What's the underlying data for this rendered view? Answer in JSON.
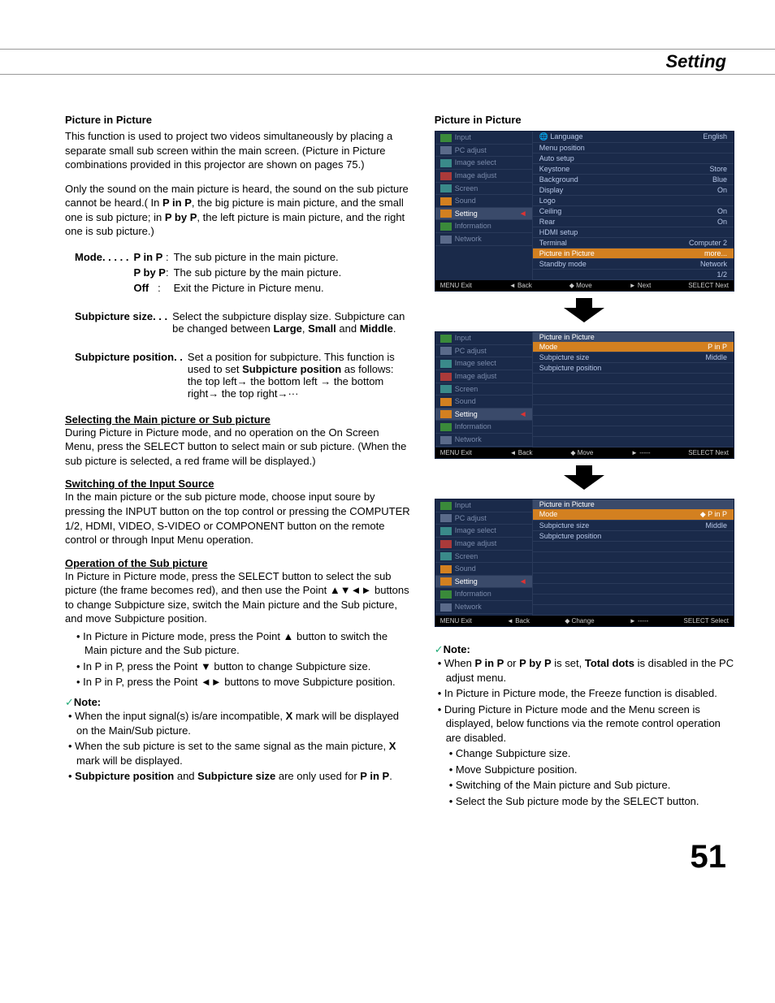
{
  "header": {
    "title": "Setting"
  },
  "left": {
    "pip_heading": "Picture in Picture",
    "pip_intro1": "This function is used to project two videos simultaneously by placing a separate small sub screen within the main screen. (Picture in Picture combinations provided in this projector are shown on pages 75.)",
    "pip_intro2_a": "Only the sound on the main picture is heard, the sound on the sub picture cannot be heard.( In ",
    "pip_intro2_b": "P in P",
    "pip_intro2_c": ", the big picture is main picture, and the small one is sub picture; in ",
    "pip_intro2_d": "P by P",
    "pip_intro2_e": ", the left picture is main picture, and the right one is sub picture.)",
    "mode_label": "Mode",
    "mode_dots": ". . . . .",
    "mode_pinp": "P in P",
    "mode_pinp_desc": "The sub picture in the main picture.",
    "mode_pbyp": "P by P",
    "mode_pbyp_desc": "The sub picture by the main picture.",
    "mode_off": "Off",
    "mode_off_desc": "Exit the Picture in Picture menu.",
    "subsize_label": "Subpicture size",
    "subsize_dots": ". . .",
    "subsize_desc_a": "Select the subpicture display size. Subpicture can be changed between ",
    "subsize_large": "Large",
    "subsize_comma1": ", ",
    "subsize_small": "Small",
    "subsize_and": " and ",
    "subsize_middle": "Middle",
    "subsize_period": ".",
    "subpos_label": "Subpicture position",
    "subpos_dots": ". .",
    "subpos_desc_a": "Set a position for subpicture. This function is used to set ",
    "subpos_desc_b": "Subpicture position",
    "subpos_desc_c": " as follows:",
    "subpos_desc_d": "the top left→ the bottom left → the bottom right→ the top right→···",
    "sel_heading": "Selecting the Main picture or Sub picture",
    "sel_text": "During Picture in Picture mode, and no operation on the On Screen Menu, press the SELECT button to select main or sub picture. (When the sub picture is selected,  a red frame will be displayed.)",
    "sw_heading": "Switching of the Input Source",
    "sw_text": "In the main picture or the sub picture mode, choose input soure by pressing the INPUT button on the top control or pressing the COMPUTER 1/2, HDMI, VIDEO, S-VIDEO or COMPONENT button on the remote control or through Input Menu operation.",
    "op_heading": "Operation of the Sub picture",
    "op_text": "In Picture in Picture mode, press the SELECT button to select the sub picture (the frame becomes red), and then use the Point ▲▼◄► buttons to change Subpicture size, switch the Main picture and the Sub picture, and move Subpicture position.",
    "op_b1": "• In Picture in Picture mode, press the Point ▲ button to switch the Main picture and the Sub picture.",
    "op_b2": "• In P in P,  press the Point ▼ button to change Subpicture size.",
    "op_b3": "• In P in P,  press the Point ◄► buttons to move Subpicture position.",
    "note_head": "Note:",
    "note_b1_a": "• When the input signal(s) is/are incompatible, ",
    "note_b1_b": "X",
    "note_b1_c": " mark will be displayed on the Main/Sub picture.",
    "note_b2_a": "• When the sub picture is set to the same signal as the main picture, ",
    "note_b2_b": "X",
    "note_b2_c": " mark will be displayed.",
    "note_b3_a": "• ",
    "note_b3_b": "Subpicture position",
    "note_b3_c": " and ",
    "note_b3_d": "Subpicture size",
    "note_b3_e": " are only used for ",
    "note_b3_f": "P in P",
    "note_b3_g": "."
  },
  "right": {
    "heading": "Picture in Picture",
    "note_head": "Note:",
    "nb1_a": "• When ",
    "nb1_b": "P in P",
    "nb1_c": " or ",
    "nb1_d": "P by P",
    "nb1_e": " is set, ",
    "nb1_f": "Total dots",
    "nb1_g": " is disabled in the PC adjust menu.",
    "nb2": "• In Picture in Picture mode, the Freeze function is disabled.",
    "nb3": "• During Picture in Picture mode and the Menu screen is displayed, below functions via the remote control operation are disabled.",
    "nb3a": "• Change Subpicture size.",
    "nb3b": "• Move Subpicture position.",
    "nb3c": "• Switching of the Main picture and Sub picture.",
    "nb3d": "• Select the Sub picture mode by the SELECT button."
  },
  "osd": {
    "side": [
      "Input",
      "PC adjust",
      "Image select",
      "Image adjust",
      "Screen",
      "Sound",
      "Setting",
      "Information",
      "Network"
    ],
    "menu1": {
      "rows": [
        {
          "l": "Language",
          "r": "English",
          "ic": true
        },
        {
          "l": "Menu position",
          "r": ""
        },
        {
          "l": "Auto setup",
          "r": ""
        },
        {
          "l": "Keystone",
          "r": "Store"
        },
        {
          "l": "Background",
          "r": "Blue"
        },
        {
          "l": "Display",
          "r": "On"
        },
        {
          "l": "Logo",
          "r": ""
        },
        {
          "l": "Ceiling",
          "r": "On"
        },
        {
          "l": "Rear",
          "r": "On"
        },
        {
          "l": "HDMI setup",
          "r": ""
        },
        {
          "l": "Terminal",
          "r": "Computer 2"
        },
        {
          "l": "Picture in Picture",
          "r": "more...",
          "hl": true
        },
        {
          "l": "Standby mode",
          "r": "Network"
        }
      ],
      "page": "1/2",
      "footer": [
        "MENU Exit",
        "◄ Back",
        "◆ Move",
        "► Next",
        "SELECT Next"
      ]
    },
    "menu2": {
      "title": "Picture in Picture",
      "rows": [
        {
          "l": "Mode",
          "r": "P in P",
          "hl": true
        },
        {
          "l": "Subpicture size",
          "r": "Middle"
        },
        {
          "l": "Subpicture position",
          "r": ""
        }
      ],
      "footer": [
        "MENU Exit",
        "◄ Back",
        "◆ Move",
        "► -----",
        "SELECT Next"
      ]
    },
    "menu3": {
      "title": "Picture in Picture",
      "rows": [
        {
          "l": "Mode",
          "r": "P in P",
          "hl": true,
          "ch": true
        },
        {
          "l": "Subpicture size",
          "r": "Middle"
        },
        {
          "l": "Subpicture position",
          "r": ""
        }
      ],
      "footer": [
        "MENU Exit",
        "◄ Back",
        "◆ Change",
        "► -----",
        "SELECT Select"
      ]
    }
  },
  "page_number": "51"
}
